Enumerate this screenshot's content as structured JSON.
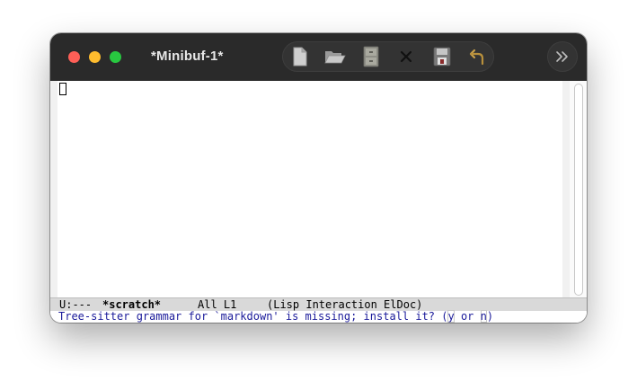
{
  "window": {
    "title": "*Minibuf-1*"
  },
  "toolbar": {
    "icons": [
      "new-file-icon",
      "open-folder-icon",
      "dired-cabinet-icon",
      "kill-buffer-x-icon",
      "save-disk-icon",
      "undo-arrow-icon",
      "overflow-chevrons-icon"
    ]
  },
  "modeline": {
    "status": "U:---",
    "buffer_name": "*scratch*",
    "position": "All L1",
    "modes": "(Lisp Interaction ElDoc)"
  },
  "minibuffer": {
    "prompt": "Tree-sitter grammar for `markdown' is missing; install it? (",
    "key_yes": "y",
    "sep": " or ",
    "key_no": "n",
    "close": ")"
  },
  "colors": {
    "titlebar": "#2a2a2a",
    "close": "#fe5f57",
    "minimize": "#febc2e",
    "zoom": "#28c840",
    "minibuffer_text": "#1a1a9a",
    "modeline_bg": "#d9d9d9"
  }
}
